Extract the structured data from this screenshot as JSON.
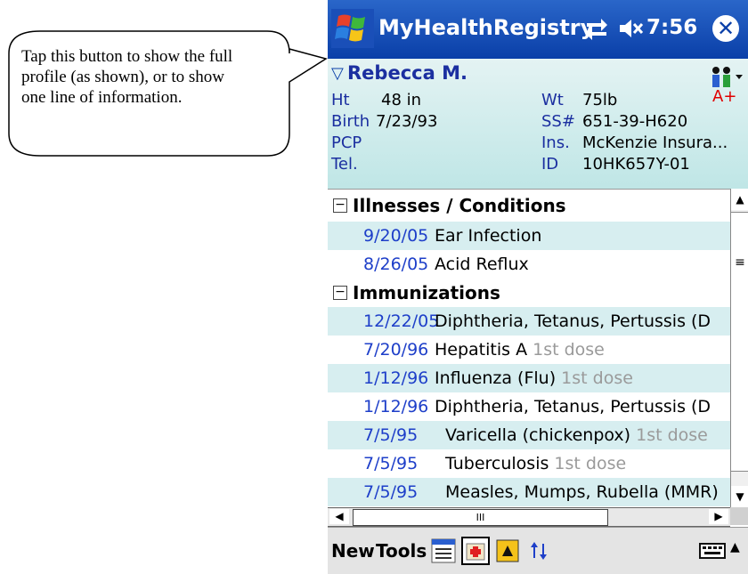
{
  "callout": {
    "text": "Tap this button to show the full profile (as shown), or to show one line of information."
  },
  "titlebar": {
    "app_title": "MyHealthRegistry",
    "time": "7:56",
    "start_icon": "windows-flag-icon",
    "sync_icon": "connectivity-icon",
    "volume_icon": "speaker-muted-icon",
    "close_symbol": "✕"
  },
  "profile": {
    "toggle": "▽",
    "name": "Rebecca M.",
    "height_label": "Ht",
    "height": "48 in",
    "weight_label": "Wt",
    "weight": "75lb",
    "birth_label": "Birth",
    "birth": "7/23/93",
    "ssn_label": "SS#",
    "ssn": "651-39-H620",
    "pcp_label": "PCP",
    "pcp": "",
    "insurance_label": "Ins.",
    "insurance": "McKenzie Insura...",
    "tel_label": "Tel.",
    "tel": "",
    "id_label": "ID",
    "id": "10HK657Y-01",
    "blood_type": "A+",
    "family_icon": "family-people-icon"
  },
  "sections": {
    "illnesses": {
      "title": "Illnesses / Conditions",
      "toggle": "−",
      "items": [
        {
          "date": "9/20/05",
          "name": "Ear Infection",
          "dose": ""
        },
        {
          "date": "8/26/05",
          "name": "Acid Reflux",
          "dose": ""
        }
      ]
    },
    "immunizations": {
      "title": "Immunizations",
      "toggle": "−",
      "items": [
        {
          "date": "12/22/05",
          "name": "Diphtheria, Tetanus, Pertussis (D",
          "dose": ""
        },
        {
          "date": "7/20/96",
          "name": "Hepatitis A",
          "dose": "1st dose"
        },
        {
          "date": "1/12/96",
          "name": "Influenza (Flu)",
          "dose": "1st dose"
        },
        {
          "date": "1/12/96",
          "name": "Diphtheria, Tetanus, Pertussis (D",
          "dose": ""
        },
        {
          "date": "7/5/95",
          "name": "Varicella (chickenpox)",
          "dose": "1st dose"
        },
        {
          "date": "7/5/95",
          "name": "Tuberculosis",
          "dose": "1st dose"
        },
        {
          "date": "7/5/95",
          "name": "Measles, Mumps, Rubella (MMR)",
          "dose": ""
        }
      ]
    }
  },
  "scrollbars": {
    "up": "▲",
    "down": "▼",
    "left": "◀",
    "right": "▶",
    "grip": "≡",
    "hgrip": "III"
  },
  "menubar": {
    "new_label": "New",
    "tools_label": "Tools",
    "keyboard_arrow": "▲"
  },
  "colors": {
    "title_bar": "#0a3fa8",
    "row_shade": "#d7eef0",
    "date_blue": "#1e3fc9",
    "blood_red": "#e00000"
  }
}
